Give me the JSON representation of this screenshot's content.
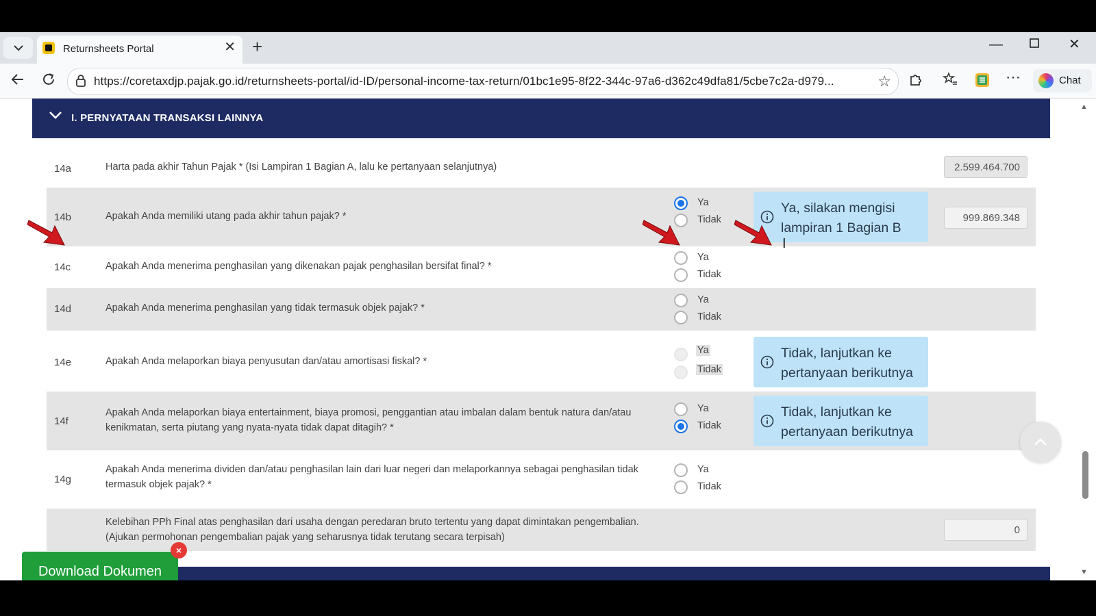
{
  "browser": {
    "tab_title": "Returnsheets Portal",
    "url": "https://coretaxdjp.pajak.go.id/returnsheets-portal/id-ID/personal-income-tax-return/01bc1e95-8f22-344c-97a6-d362c49dfa81/5cbe7c2a-d979...",
    "chat_label": "Chat"
  },
  "section": {
    "title": "I. PERNYATAAN TRANSAKSI LAINNYA"
  },
  "options": {
    "yes": "Ya",
    "no": "Tidak"
  },
  "rows": [
    {
      "code": "14a",
      "text": "Harta pada akhir Tahun Pajak * (Isi Lampiran 1 Bagian A, lalu ke pertanyaan selanjutnya)",
      "value": "2.599.464.700"
    },
    {
      "code": "14b",
      "text": "Apakah Anda memiliki utang pada akhir tahun pajak? *",
      "selected": "Ya",
      "info": "Ya, silakan mengisi lampiran 1 Bagian B",
      "value": "999.869.348"
    },
    {
      "code": "14c",
      "text": "Apakah Anda menerima penghasilan yang dikenakan pajak penghasilan bersifat final? *"
    },
    {
      "code": "14d",
      "text": "Apakah Anda menerima penghasilan yang tidak termasuk objek pajak? *"
    },
    {
      "code": "14e",
      "text": "Apakah Anda melaporkan biaya penyusutan dan/atau amortisasi fiskal? *",
      "info": "Tidak, lanjutkan ke pertanyaan berikutnya"
    },
    {
      "code": "14f",
      "text": "Apakah Anda melaporkan biaya entertainment, biaya promosi, penggantian atau imbalan dalam bentuk natura dan/atau kenikmatan, serta piutang yang nyata-nyata tidak dapat ditagih? *",
      "selected": "Tidak",
      "info": "Tidak, lanjutkan ke pertanyaan berikutnya"
    },
    {
      "code": "14g",
      "text": "Apakah Anda menerima dividen dan/atau penghasilan lain dari luar negeri dan melaporkannya sebagai penghasilan tidak termasuk objek pajak? *"
    },
    {
      "code": "",
      "text": "Kelebihan PPh Final atas penghasilan dari usaha dengan peredaran bruto tertentu yang dapat dimintakan pengembalian. (Ajukan permohonan pengembalian pajak yang seharusnya tidak terutang secara terpisah)",
      "value": "0"
    }
  ],
  "download_button": "Download Dokumen",
  "colors": {
    "header_bg": "#1e2b63",
    "info_bg": "#bee3f8",
    "radio_checked": "#1a73e8",
    "download_bg": "#1f9e3a",
    "arrow": "#d0191f"
  }
}
